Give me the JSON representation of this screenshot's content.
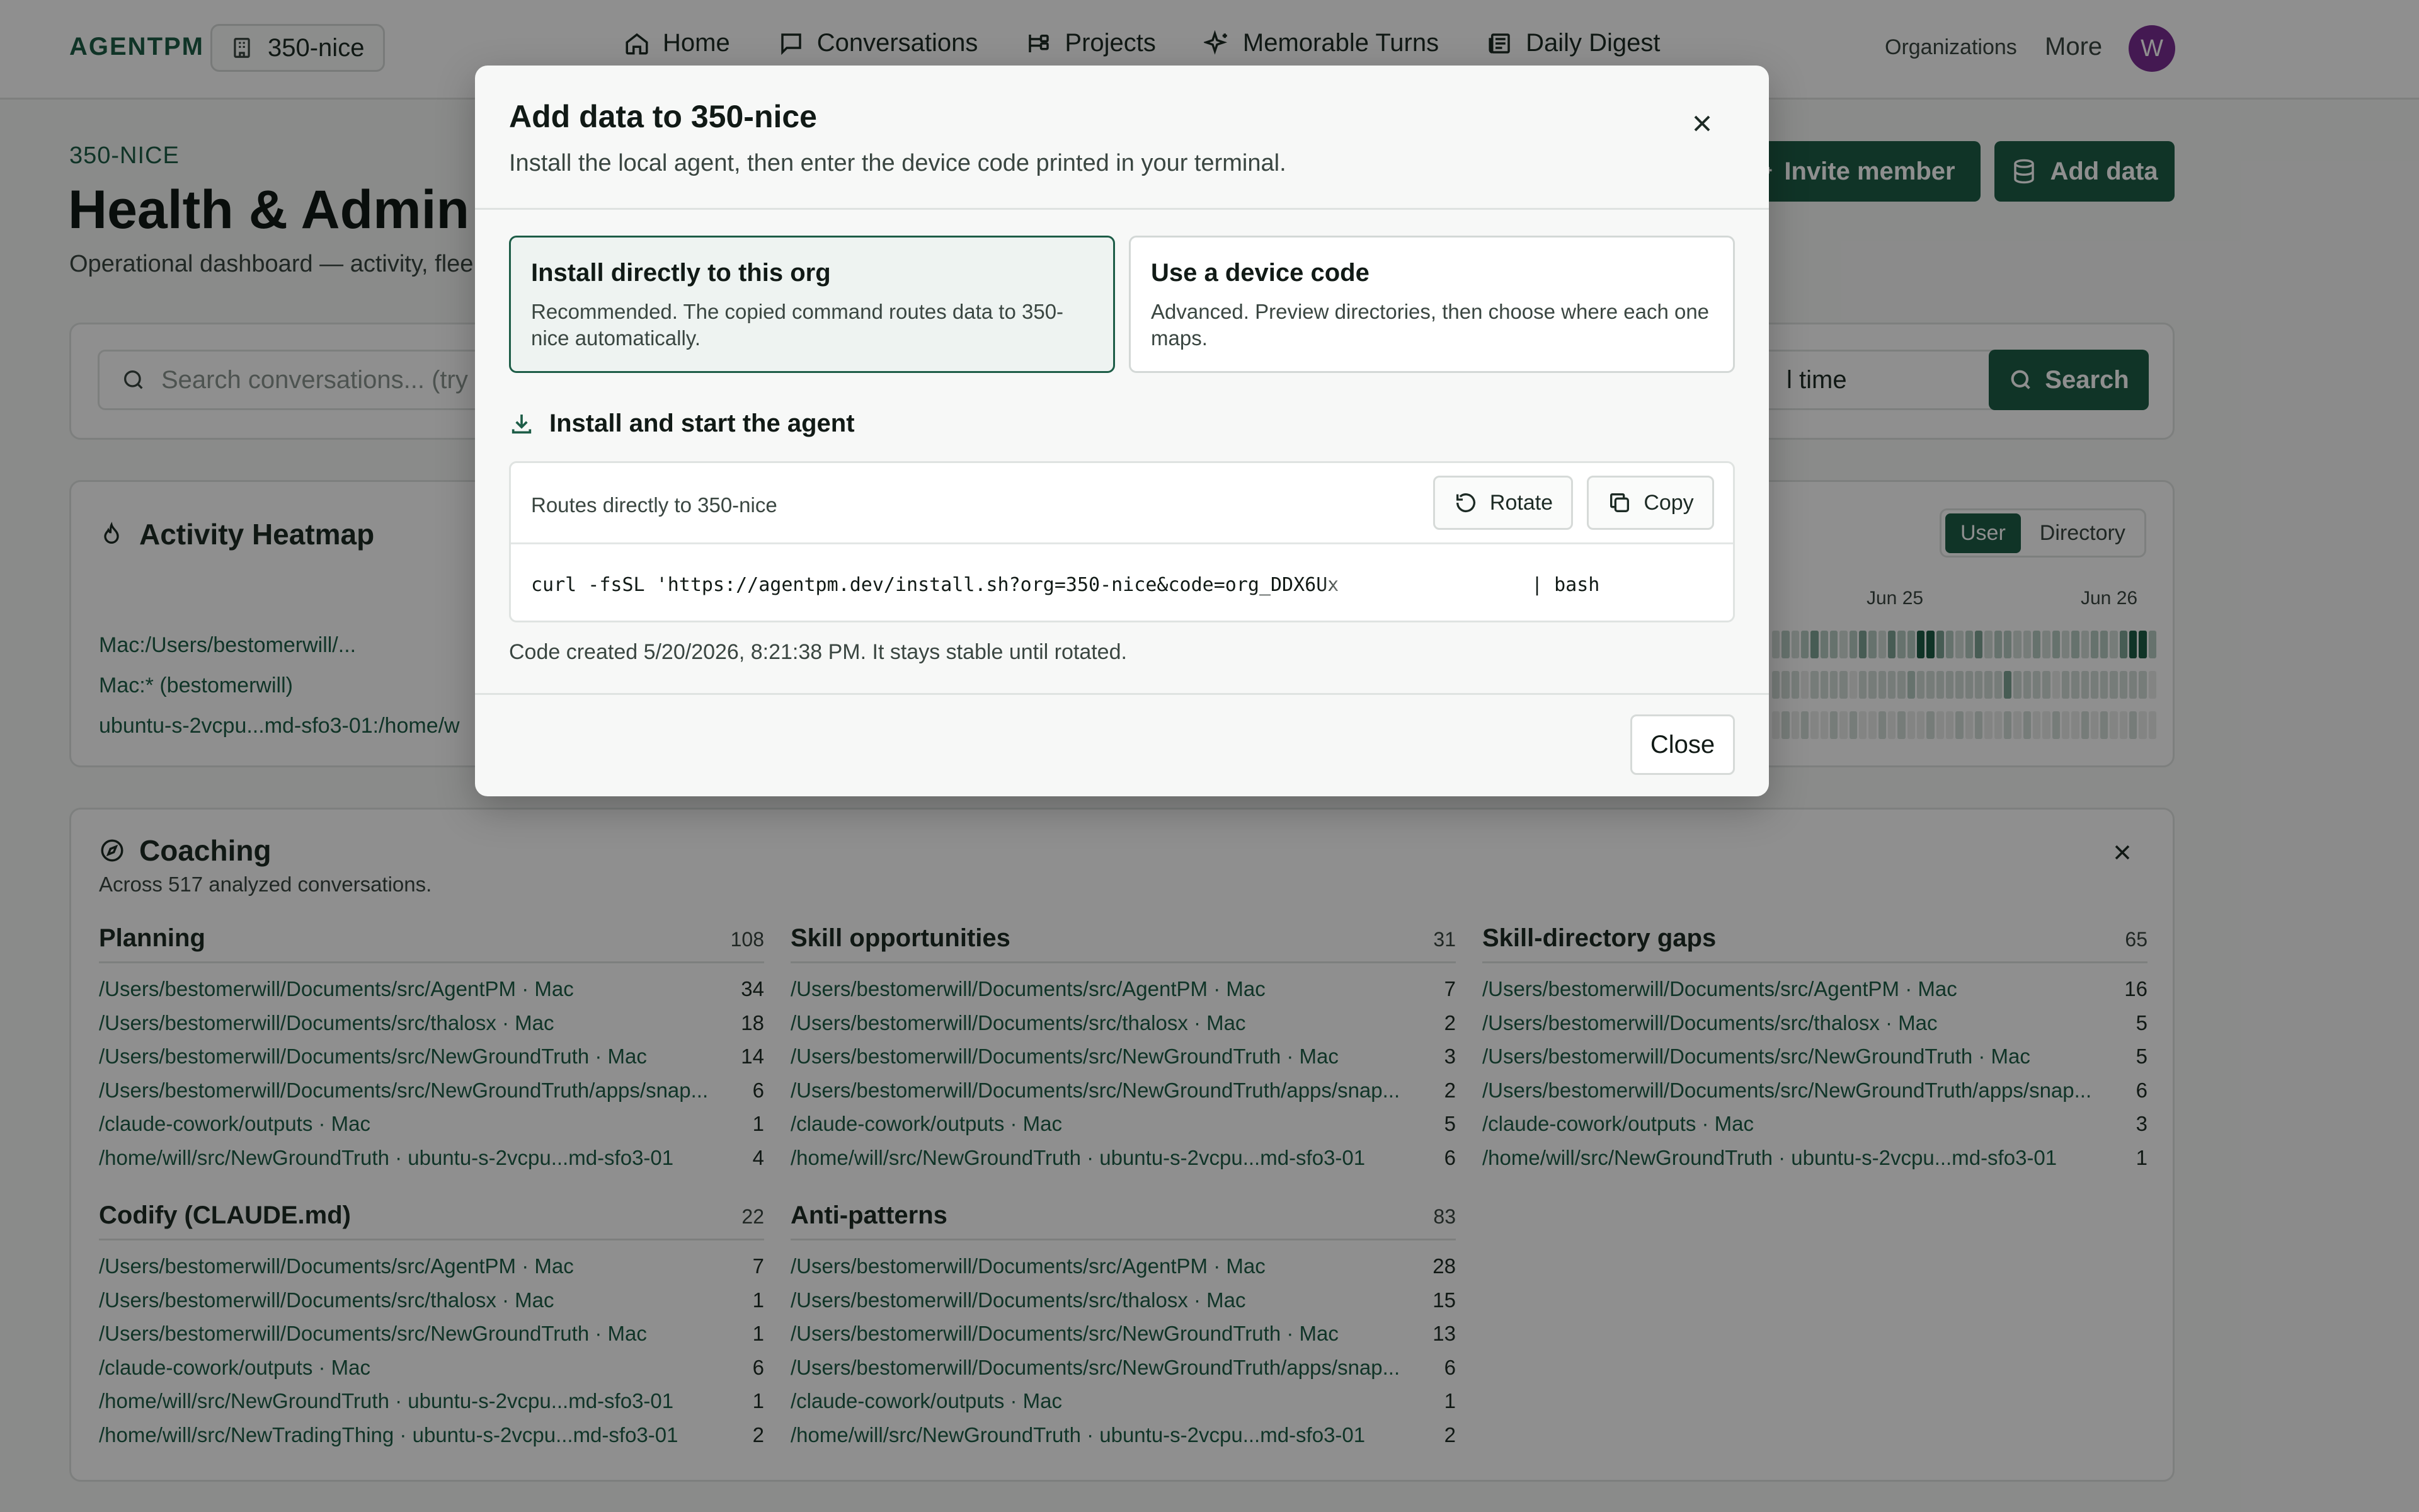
{
  "topbar": {
    "brand": "AGENTPM",
    "org_pill": "350-nice",
    "nav": [
      {
        "label": "Home",
        "icon": "home-icon"
      },
      {
        "label": "Conversations",
        "icon": "chat-icon"
      },
      {
        "label": "Projects",
        "icon": "projects-icon"
      },
      {
        "label": "Memorable Turns",
        "icon": "sparkle-icon"
      },
      {
        "label": "Daily Digest",
        "icon": "newspaper-icon"
      }
    ],
    "organizations": "Organizations",
    "more": "More",
    "avatar_initial": "W",
    "avatar_color": "#7a2d92"
  },
  "page": {
    "org_label": "350-NICE",
    "title": "Health & Admin",
    "subtitle": "Operational dashboard — activity, flee",
    "invite_button": "Invite member",
    "add_data_button": "Add data"
  },
  "search": {
    "placeholder": "Search conversations... (try p",
    "time_range": "l time",
    "button": "Search"
  },
  "heatmap": {
    "title": "Activity Heatmap",
    "toggle": [
      "User",
      "Directory"
    ],
    "active_toggle": "User",
    "dates": [
      "Jun 25",
      "Jun 26"
    ],
    "rows": [
      "Mac:/Users/bestomerwill/...",
      "Mac:* (bestomerwill)",
      "ubuntu-s-2vcpu...md-sfo3-01:/home/w"
    ]
  },
  "coaching": {
    "title": "Coaching",
    "subtitle": "Across 517 analyzed conversations.",
    "sections": [
      {
        "title": "Planning",
        "count": "108",
        "items": [
          {
            "label": "/Users/bestomerwill/Documents/src/AgentPM · Mac",
            "count": "34"
          },
          {
            "label": "/Users/bestomerwill/Documents/src/thalosx · Mac",
            "count": "18"
          },
          {
            "label": "/Users/bestomerwill/Documents/src/NewGroundTruth · Mac",
            "count": "14"
          },
          {
            "label": "/Users/bestomerwill/Documents/src/NewGroundTruth/apps/snap...",
            "count": "6"
          },
          {
            "label": "/claude-cowork/outputs · Mac",
            "count": "1"
          },
          {
            "label": "/home/will/src/NewGroundTruth · ubuntu-s-2vcpu...md-sfo3-01",
            "count": "4"
          }
        ]
      },
      {
        "title": "Skill opportunities",
        "count": "31",
        "items": [
          {
            "label": "/Users/bestomerwill/Documents/src/AgentPM · Mac",
            "count": "7"
          },
          {
            "label": "/Users/bestomerwill/Documents/src/thalosx · Mac",
            "count": "2"
          },
          {
            "label": "/Users/bestomerwill/Documents/src/NewGroundTruth · Mac",
            "count": "3"
          },
          {
            "label": "/Users/bestomerwill/Documents/src/NewGroundTruth/apps/snap...",
            "count": "2"
          },
          {
            "label": "/claude-cowork/outputs · Mac",
            "count": "5"
          },
          {
            "label": "/home/will/src/NewGroundTruth · ubuntu-s-2vcpu...md-sfo3-01",
            "count": "6"
          }
        ]
      },
      {
        "title": "Skill-directory gaps",
        "count": "65",
        "items": [
          {
            "label": "/Users/bestomerwill/Documents/src/AgentPM · Mac",
            "count": "16"
          },
          {
            "label": "/Users/bestomerwill/Documents/src/thalosx · Mac",
            "count": "5"
          },
          {
            "label": "/Users/bestomerwill/Documents/src/NewGroundTruth · Mac",
            "count": "5"
          },
          {
            "label": "/Users/bestomerwill/Documents/src/NewGroundTruth/apps/snap...",
            "count": "6"
          },
          {
            "label": "/claude-cowork/outputs · Mac",
            "count": "3"
          },
          {
            "label": "/home/will/src/NewGroundTruth · ubuntu-s-2vcpu...md-sfo3-01",
            "count": "1"
          }
        ]
      },
      {
        "title": "Codify (CLAUDE.md)",
        "count": "22",
        "items": [
          {
            "label": "/Users/bestomerwill/Documents/src/AgentPM · Mac",
            "count": "7"
          },
          {
            "label": "/Users/bestomerwill/Documents/src/thalosx · Mac",
            "count": "1"
          },
          {
            "label": "/Users/bestomerwill/Documents/src/NewGroundTruth · Mac",
            "count": "1"
          },
          {
            "label": "/claude-cowork/outputs · Mac",
            "count": "6"
          },
          {
            "label": "/home/will/src/NewGroundTruth · ubuntu-s-2vcpu...md-sfo3-01",
            "count": "1"
          },
          {
            "label": "/home/will/src/NewTradingThing · ubuntu-s-2vcpu...md-sfo3-01",
            "count": "2"
          }
        ]
      },
      {
        "title": "Anti-patterns",
        "count": "83",
        "items": [
          {
            "label": "/Users/bestomerwill/Documents/src/AgentPM · Mac",
            "count": "28"
          },
          {
            "label": "/Users/bestomerwill/Documents/src/thalosx · Mac",
            "count": "15"
          },
          {
            "label": "/Users/bestomerwill/Documents/src/NewGroundTruth · Mac",
            "count": "13"
          },
          {
            "label": "/Users/bestomerwill/Documents/src/NewGroundTruth/apps/snap...",
            "count": "6"
          },
          {
            "label": "/claude-cowork/outputs · Mac",
            "count": "1"
          },
          {
            "label": "/home/will/src/NewGroundTruth · ubuntu-s-2vcpu...md-sfo3-01",
            "count": "2"
          }
        ]
      }
    ]
  },
  "modal": {
    "title": "Add data to 350-nice",
    "subtitle": "Install the local agent, then enter the device code printed in your terminal.",
    "option_direct": {
      "title": "Install directly to this org",
      "desc": "Recommended. The copied command routes data to 350-nice automatically."
    },
    "option_device": {
      "title": "Use a device code",
      "desc": "Advanced. Preview directories, then choose where each one maps."
    },
    "install_heading": "Install and start the agent",
    "routes": "Routes directly to 350-nice",
    "rotate_button": "Rotate",
    "copy_button": "Copy",
    "command": "curl -fsSL 'https://agentpm.dev/install.sh?org=350-nice&code=org_DDX6Ux",
    "command_tail": "| bash",
    "created": "Code created 5/20/2026, 8:21:38 PM. It stays stable until rotated.",
    "close_button": "Close"
  },
  "colors": {
    "accent": "#1d5d47",
    "overlay": "rgba(0,0,0,0.44)"
  }
}
